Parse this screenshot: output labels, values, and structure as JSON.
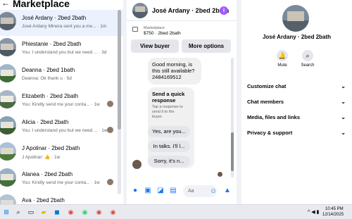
{
  "left": {
    "back_glyph": "←",
    "title": "Marketplace",
    "conversations": [
      {
        "name": "José Ardany · 2bed 2bath",
        "snippet": "José Ardany Minera sent you a me... · 1m",
        "active": true
      },
      {
        "name": "Phiestanie · 2bed 2bath",
        "snippet": "You: I understand you but we need ... · 3d",
        "active": false
      },
      {
        "name": "Deanna · 2bed 1bath",
        "snippet": "Deanna: Ok thank u · 5d",
        "active": false
      },
      {
        "name": "Elizabeth · 2bed 2bath",
        "snippet": "You: Kindly send me your conta... · 1w",
        "active": false
      },
      {
        "name": "Alicia · 2bed 2bath",
        "snippet": "You: I understand you but we need ... · 1w",
        "active": false
      },
      {
        "name": "J Apolinar · 2bed 2bath",
        "snippet": "J Apolinar: 👍 · 1w",
        "active": false
      },
      {
        "name": "Alanea · 2bed 2bath",
        "snippet": "You: Kindly send me your conta... · 1w",
        "active": false
      },
      {
        "name": "Ava · 2bed 2bath",
        "snippet": "You: Kindly send me your conta... · 1w",
        "active": false
      }
    ]
  },
  "chat": {
    "header_name": "José Ardany · 2bed 2bath",
    "info_glyph": "i",
    "listing_label": "Marketplace",
    "listing_detail": "$750 · 2bed 2bath",
    "view_buyer": "View buyer",
    "more_options": "More options",
    "message_1": [
      "Good morning, is",
      "this still available?",
      "2484169512"
    ],
    "quick_title": [
      "Send a quick",
      "response"
    ],
    "quick_sub": [
      "Tap a response to",
      "send it to the",
      "buyer."
    ],
    "quick_replies": [
      "Yes, are you...",
      "In talks. I'll l...",
      "Sorry, it's n..."
    ],
    "composer_placeholder": "Aa",
    "composer_icons": [
      "mic-icon",
      "image-icon",
      "sticker-icon",
      "gif-icon",
      "emoji-icon",
      "like-icon"
    ]
  },
  "right": {
    "name": "José Ardany · 2bed 2bath",
    "actions": [
      {
        "label": "Mute",
        "icon": "bell-icon"
      },
      {
        "label": "Search",
        "icon": "search-icon"
      }
    ],
    "sections": [
      "Customize chat",
      "Chat members",
      "Media, files and links",
      "Privacy & support"
    ]
  },
  "taskbar": {
    "time": "10:45 PM",
    "date": "12/14/2025",
    "apps": [
      "windows-start-icon",
      "search-icon",
      "task-view-icon",
      "file-explorer-icon",
      "store-icon",
      "chrome-icon",
      "whatsapp-icon",
      "chrome-icon",
      "chrome-icon"
    ]
  }
}
